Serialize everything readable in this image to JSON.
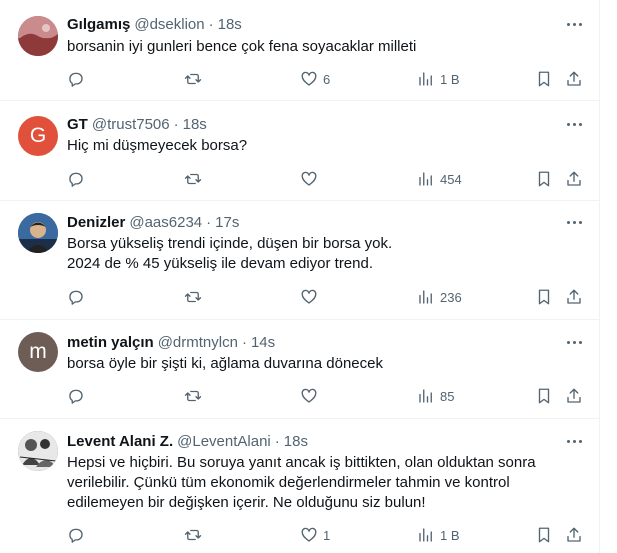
{
  "tweets": [
    {
      "name": "Gılgamış",
      "handle": "@dseklion",
      "dot": "·",
      "time": "18s",
      "text": [
        "borsanin iyi gunleri bence çok fena soyacaklar milleti"
      ],
      "replies": "",
      "retweets": "",
      "likes": "6",
      "views": "1 B",
      "avatar": {
        "type": "image",
        "icon": "photo-avatar",
        "color": "#a84a4a"
      }
    },
    {
      "name": "GT",
      "handle": "@trust7506",
      "dot": "·",
      "time": "18s",
      "text": [
        "Hiç mi düşmeyecek borsa?"
      ],
      "replies": "",
      "retweets": "",
      "likes": "",
      "views": "454",
      "avatar": {
        "type": "letter",
        "letter": "G",
        "color": "#e0503a"
      }
    },
    {
      "name": "Denizler",
      "handle": "@aas6234",
      "dot": "·",
      "time": "17s",
      "text": [
        "Borsa yükseliş trendi içinde, düşen bir borsa yok.",
        "2024 de % 45 yükseliş ile devam ediyor trend."
      ],
      "replies": "",
      "retweets": "",
      "likes": "",
      "views": "236",
      "avatar": {
        "type": "image",
        "icon": "photo-avatar",
        "color": "#2a4d7a"
      }
    },
    {
      "name": "metin yalçın",
      "handle": "@drmtnylcn",
      "dot": "·",
      "time": "14s",
      "text": [
        "borsa öyle bir şişti ki, ağlama duvarına dönecek"
      ],
      "replies": "",
      "retweets": "",
      "likes": "",
      "views": "85",
      "avatar": {
        "type": "letter",
        "letter": "m",
        "color": "#6d5d54"
      }
    },
    {
      "name": "Levent Alani Z.",
      "handle": "@LeventAlani",
      "dot": "·",
      "time": "18s",
      "text": [
        "Hepsi ve hiçbiri. Bu soruya yanıt ancak iş bittikten, olan olduktan sonra",
        "verilebilir. Çünkü tüm ekonomik değerlendirmeler tahmin ve kontrol",
        "edilemeyen bir değişken içerir. Ne olduğunu siz bulun!"
      ],
      "replies": "",
      "retweets": "",
      "likes": "1",
      "views": "1 B",
      "avatar": {
        "type": "image",
        "icon": "photo-avatar",
        "color": "#4a4a4a"
      }
    }
  ]
}
